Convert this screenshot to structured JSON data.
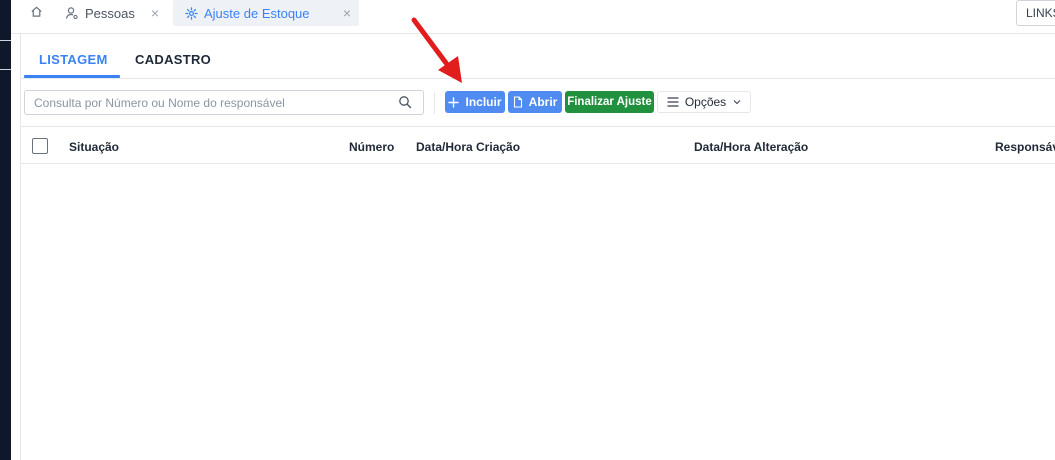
{
  "tabs": {
    "home_label": "",
    "pessoas": {
      "label": "Pessoas",
      "close": "×"
    },
    "ajuste": {
      "label": "Ajuste de Estoque",
      "close": "×"
    },
    "links_label": "LINKS"
  },
  "subtabs": [
    {
      "label": "LISTAGEM",
      "active": true
    },
    {
      "label": "CADASTRO",
      "active": false
    }
  ],
  "search": {
    "placeholder": "Consulta por Número ou Nome do responsável",
    "value": ""
  },
  "toolbar": {
    "incluir_label": "Incluir",
    "abrir_label": "Abrir",
    "finalizar_label": "Finalizar Ajuste",
    "opcoes_label": "Opções"
  },
  "table": {
    "columns": [
      "Situação",
      "Número",
      "Data/Hora Criação",
      "Data/Hora Alteração",
      "Responsáve"
    ],
    "rows": []
  },
  "colors": {
    "primary": "#4f8bf0",
    "success": "#22913f",
    "active_tab": "#3b82f6",
    "annotation": "#e11d1d"
  },
  "icons": {
    "home": "home-icon",
    "pessoas": "user-gear-icon",
    "ajuste": "gear-icon",
    "search": "search-icon",
    "incluir": "plus-icon",
    "abrir": "document-icon",
    "opcoes": "menu-icon",
    "opcoes_caret": "chevron-down-icon",
    "annotation": "red-arrow-icon"
  }
}
